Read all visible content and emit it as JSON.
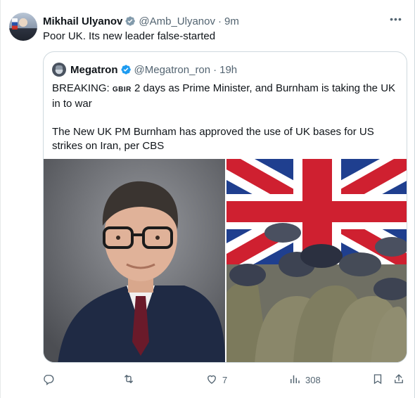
{
  "colors": {
    "text": "#0f1419",
    "muted": "#536471",
    "verified": "#829aab",
    "verified_quote": "#1d9bf0",
    "border": "#cfd9de"
  },
  "tweet": {
    "author_name": "Mikhail Ulyanov",
    "handle": "@Amb_Ulyanov",
    "separator": "·",
    "time": "9m",
    "text": "Poor UK. Its new leader false-started",
    "more_label": "•••"
  },
  "quote": {
    "author_name": "Megatron",
    "handle": "@Megatron_ron",
    "separator": "·",
    "time": "19h",
    "breaking_prefix": "BREAKING: ",
    "flag_abbr": "GBIR",
    "breaking_rest": " 2 days as Prime Minister, and Burnham is taking the UK in to war",
    "paragraph2": "The New UK PM Burnham has approved the use of UK bases for US strikes on Iran, per CBS"
  },
  "actions": {
    "reply": {
      "icon": "reply-icon",
      "count": ""
    },
    "repost": {
      "icon": "repost-icon",
      "count": ""
    },
    "like": {
      "icon": "heart-icon",
      "count": "7"
    },
    "views": {
      "icon": "views-icon",
      "count": "308"
    },
    "bookmark": {
      "icon": "bookmark-icon"
    },
    "share": {
      "icon": "share-icon"
    }
  }
}
